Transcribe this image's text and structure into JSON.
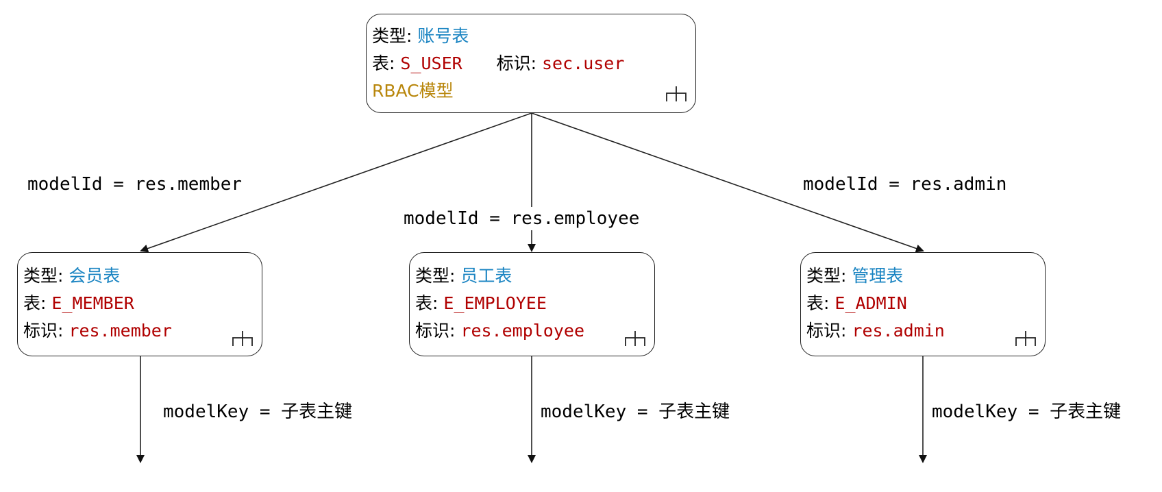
{
  "root": {
    "type_label": "类型:",
    "type_value": "账号表",
    "table_label": "表:",
    "table_value": "S_USER",
    "id_label": "标识:",
    "id_value": "sec.user",
    "model": "RBAC模型",
    "hierarchy_icon": "hierarchy-icon"
  },
  "children": [
    {
      "type_label": "类型:",
      "type_value": "会员表",
      "table_label": "表:",
      "table_value": "E_MEMBER",
      "id_label": "标识:",
      "id_value": "res.member",
      "hierarchy_icon": "hierarchy-icon"
    },
    {
      "type_label": "类型:",
      "type_value": "员工表",
      "table_label": "表:",
      "table_value": "E_EMPLOYEE",
      "id_label": "标识:",
      "id_value": "res.employee",
      "hierarchy_icon": "hierarchy-icon"
    },
    {
      "type_label": "类型:",
      "type_value": "管理表",
      "table_label": "表:",
      "table_value": "E_ADMIN",
      "id_label": "标识:",
      "id_value": "res.admin",
      "hierarchy_icon": "hierarchy-icon"
    }
  ],
  "edges": {
    "member": "modelId = res.member",
    "employee": "modelId = res.employee",
    "admin": "modelId = res.admin"
  },
  "key_edges": [
    "modelKey = 子表主键",
    "modelKey = 子表主键",
    "modelKey = 子表主键"
  ],
  "colors": {
    "type_value": "#1a84c2",
    "table_value": "#b00000",
    "model": "#b8860b",
    "stroke": "#222222"
  }
}
